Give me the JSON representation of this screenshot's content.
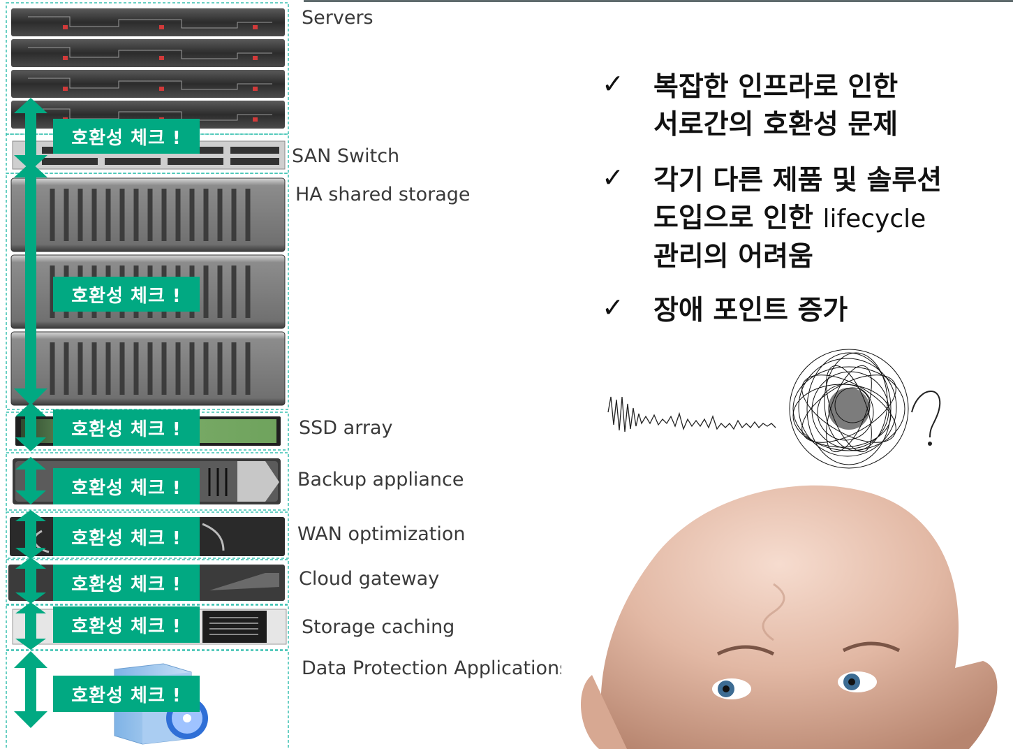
{
  "labels": {
    "servers": "Servers",
    "san_switch": "SAN Switch",
    "ha_storage": "HA shared storage",
    "ssd_array": "SSD array",
    "backup": "Backup appliance",
    "wan": "WAN optimization",
    "cloud": "Cloud gateway",
    "caching": "Storage caching",
    "data_protection": "Data Protection Applications"
  },
  "badge_text": "호환성 체크 !",
  "bullets": [
    {
      "line1": "복잡한 인프라로 인한",
      "line2": "서로간의 호환성 문제"
    },
    {
      "line1": "각기 다른 제품 및 솔루션",
      "line2a": "도입으로 인한 ",
      "line2b": "lifecycle",
      "line3": "관리의 어려움"
    },
    {
      "line1": "장애 포인트 증가"
    }
  ],
  "check_glyph": "✓",
  "colors": {
    "accent": "#01a982",
    "dash": "#39c1b0",
    "rack_dark": "#2b2b2b"
  }
}
